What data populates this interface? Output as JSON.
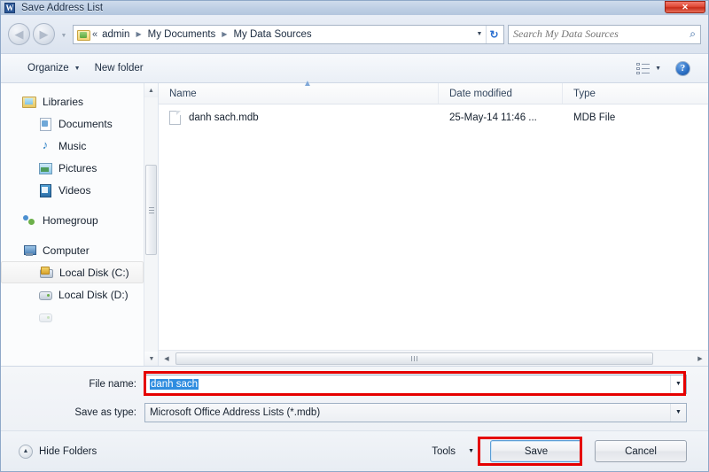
{
  "window": {
    "title": "Save Address List",
    "app_icon": "word-icon",
    "app_icon_letter": "W",
    "close_label": "✕"
  },
  "nav": {
    "back_icon": "back-arrow-icon",
    "back_glyph": "◀",
    "forward_icon": "forward-arrow-icon",
    "forward_glyph": "▶",
    "history_caret": "▼",
    "folder_icon": "folder-icon",
    "breadcrumb_prefix": "«",
    "breadcrumbs": [
      "admin",
      "My Documents",
      "My Data Sources"
    ],
    "breadcrumb_separator": "▶",
    "address_caret": "▼",
    "refresh_icon": "refresh-icon",
    "refresh_glyph": "↻"
  },
  "search": {
    "placeholder": "Search My Data Sources",
    "value": "",
    "icon": "search-icon",
    "icon_glyph": "⌕"
  },
  "toolbar": {
    "organize_label": "Organize",
    "organize_caret": "▼",
    "new_folder_label": "New folder",
    "view_icon": "list-view-icon",
    "view_caret": "▼",
    "help_icon": "help-icon",
    "help_glyph": "?"
  },
  "sidebar": {
    "items": [
      {
        "label": "Libraries",
        "icon": "library-icon",
        "level": 0,
        "selected": false,
        "group": false
      },
      {
        "label": "Documents",
        "icon": "documents-icon",
        "level": 1,
        "selected": false,
        "group": false
      },
      {
        "label": "Music",
        "icon": "music-icon",
        "level": 1,
        "selected": false,
        "group": false
      },
      {
        "label": "Pictures",
        "icon": "pictures-icon",
        "level": 1,
        "selected": false,
        "group": false
      },
      {
        "label": "Videos",
        "icon": "videos-icon",
        "level": 1,
        "selected": false,
        "group": false
      },
      {
        "label": "Homegroup",
        "icon": "homegroup-icon",
        "level": 0,
        "selected": false,
        "group": true
      },
      {
        "label": "Computer",
        "icon": "computer-icon",
        "level": 0,
        "selected": false,
        "group": true
      },
      {
        "label": "Local Disk (C:)",
        "icon": "local-disk-c-icon",
        "level": 1,
        "selected": true,
        "group": false
      },
      {
        "label": "Local Disk (D:)",
        "icon": "local-disk-d-icon",
        "level": 1,
        "selected": false,
        "group": false
      }
    ],
    "scrollbar": {
      "up_glyph": "▲",
      "down_glyph": "▼"
    }
  },
  "filelist": {
    "columns": [
      "Name",
      "Date modified",
      "Type"
    ],
    "sort_indicator": "▲",
    "rows": [
      {
        "name": "danh sach.mdb",
        "date_modified": "25-May-14 11:46 ...",
        "type": "MDB File",
        "icon": "file-icon"
      }
    ],
    "hscroll": {
      "left_glyph": "◀",
      "right_glyph": "▶"
    }
  },
  "form": {
    "file_name_label": "File name:",
    "file_name_value": "danh sach",
    "file_name_caret": "▼",
    "save_as_type_label": "Save as type:",
    "save_as_type_value": "Microsoft Office Address Lists (*.mdb)",
    "save_as_type_caret": "▼"
  },
  "footer": {
    "hide_folders_label": "Hide Folders",
    "hide_folders_icon": "collapse-up-icon",
    "hide_folders_glyph": "▲",
    "tools_label": "Tools",
    "tools_caret": "▼",
    "save_label": "Save",
    "cancel_label": "Cancel"
  },
  "annotations": {
    "highlight_color": "#e50000",
    "selection_color": "#2f8de0"
  }
}
